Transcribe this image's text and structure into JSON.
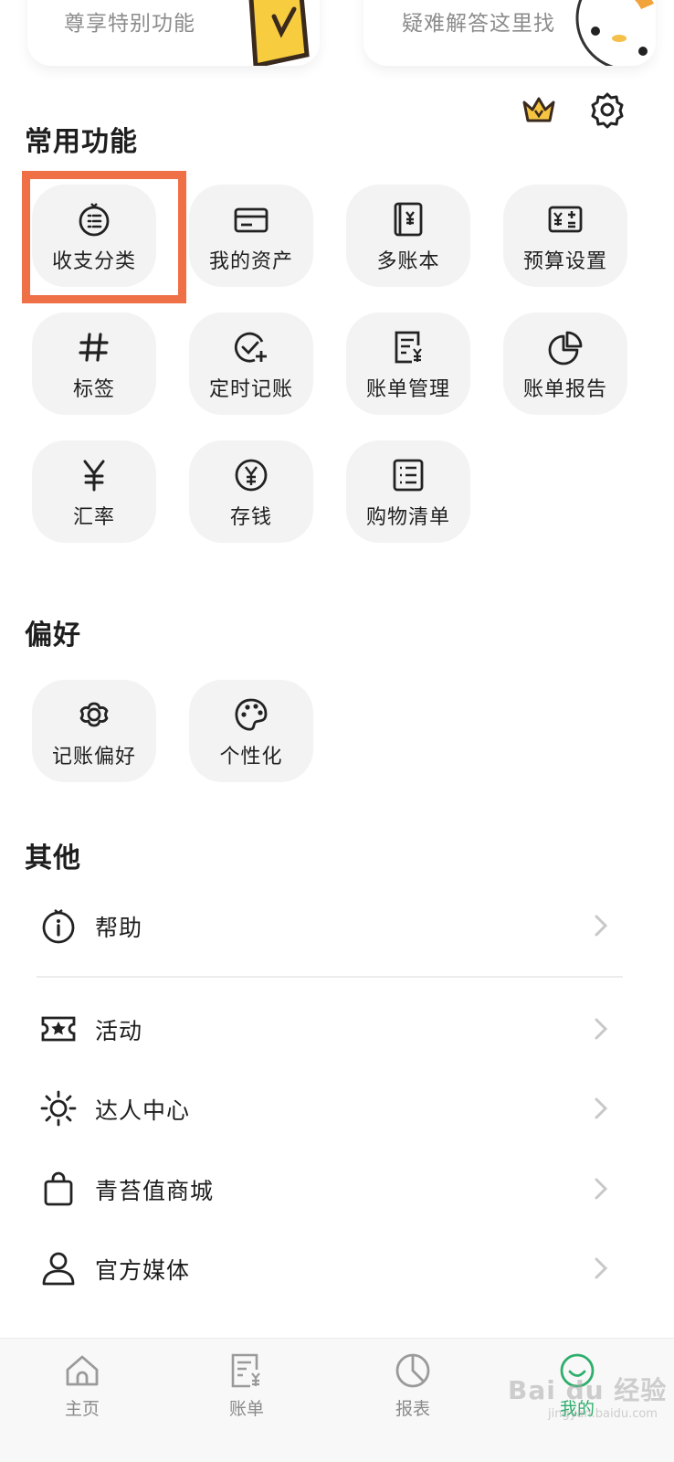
{
  "promo": {
    "left_text": "尊享特别功能",
    "right_text": "疑难解答这里找"
  },
  "sections": {
    "common": "常用功能",
    "preference": "偏好",
    "other": "其他"
  },
  "common_tiles": [
    {
      "label": "收支分类",
      "icon": "category-list-icon"
    },
    {
      "label": "我的资产",
      "icon": "card-icon"
    },
    {
      "label": "多账本",
      "icon": "ledger-book-icon"
    },
    {
      "label": "预算设置",
      "icon": "budget-calculator-icon"
    },
    {
      "label": "标签",
      "icon": "hashtag-icon"
    },
    {
      "label": "定时记账",
      "icon": "scheduled-check-icon"
    },
    {
      "label": "账单管理",
      "icon": "bill-manage-icon"
    },
    {
      "label": "账单报告",
      "icon": "pie-report-icon"
    },
    {
      "label": "汇率",
      "icon": "yen-icon"
    },
    {
      "label": "存钱",
      "icon": "coin-yen-icon"
    },
    {
      "label": "购物清单",
      "icon": "shopping-list-icon"
    }
  ],
  "preference_tiles": [
    {
      "label": "记账偏好",
      "icon": "flower-gear-icon"
    },
    {
      "label": "个性化",
      "icon": "palette-icon"
    }
  ],
  "other_rows": [
    {
      "label": "帮助",
      "icon": "info-icon"
    },
    {
      "label": "活动",
      "icon": "ticket-star-icon"
    },
    {
      "label": "达人中心",
      "icon": "sun-icon"
    },
    {
      "label": "青苔值商城",
      "icon": "shopping-bag-icon"
    },
    {
      "label": "官方媒体",
      "icon": "person-icon"
    }
  ],
  "tabbar": [
    {
      "label": "主页",
      "icon": "home-icon"
    },
    {
      "label": "账单",
      "icon": "bill-icon"
    },
    {
      "label": "报表",
      "icon": "report-pie-icon"
    },
    {
      "label": "我的",
      "icon": "profile-smile-icon",
      "active": true
    }
  ],
  "colors": {
    "highlight": "#ef7046",
    "active_tab": "#2eae6b",
    "tile_bg": "#f3f3f3"
  },
  "watermark": {
    "main": "Bai du 经验",
    "sub": "jingyan.baidu.com"
  }
}
